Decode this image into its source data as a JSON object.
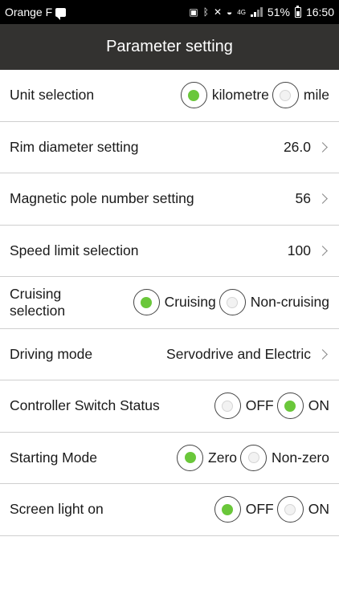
{
  "status_bar": {
    "carrier": "Orange F",
    "network": "4G",
    "battery": "51%",
    "time": "16:50"
  },
  "header": {
    "title": "Parameter setting"
  },
  "colors": {
    "selected": "#6ac73a",
    "title_bar": "#333230"
  },
  "settings": {
    "unit": {
      "label": "Unit selection",
      "options": [
        "kilometre",
        "mile"
      ],
      "selected": "kilometre"
    },
    "rim": {
      "label": "Rim diameter setting",
      "value": "26.0"
    },
    "magnet": {
      "label": "Magnetic pole number setting",
      "value": "56"
    },
    "speed": {
      "label": "Speed limit selection",
      "value": "100"
    },
    "cruising": {
      "label": "Cruising selection",
      "options": [
        "Cruising",
        "Non-cruising"
      ],
      "selected": "Cruising"
    },
    "driving": {
      "label": "Driving mode",
      "value": "Servodrive and Electric"
    },
    "controller": {
      "label": "Controller Switch Status",
      "options": [
        "OFF",
        "ON"
      ],
      "selected": "ON"
    },
    "starting": {
      "label": "Starting Mode",
      "options": [
        "Zero",
        "Non-zero"
      ],
      "selected": "Zero"
    },
    "screen": {
      "label": "Screen light on",
      "options": [
        "OFF",
        "ON"
      ],
      "selected": "OFF"
    }
  }
}
